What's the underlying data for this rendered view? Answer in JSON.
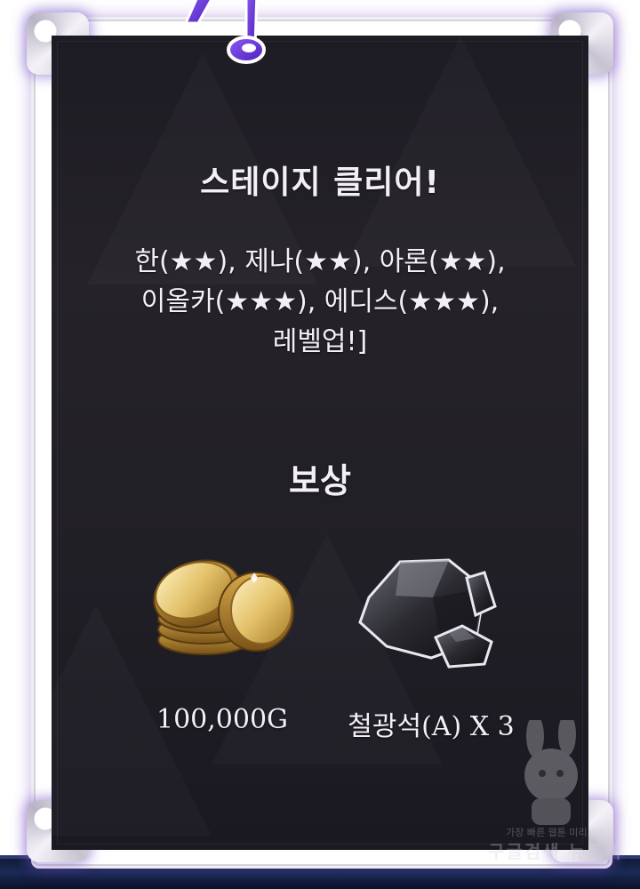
{
  "dialog": {
    "title": "스테이지 클리어!",
    "description_lines": [
      "한(★★), 제나(★★), 아론(★★),",
      "이올카(★★★), 에디스(★★★),",
      "레벨업!]"
    ]
  },
  "rewards": {
    "heading": "보상",
    "items": [
      {
        "label": "100,000G",
        "icon": "gold-coins-icon"
      },
      {
        "label": "철광석(A) X 3",
        "icon": "iron-ore-icon"
      }
    ]
  },
  "watermark": {
    "line1": "가장 빠른 웹툰 미리보기",
    "line2": "구글검색 뉴토끼"
  },
  "colors": {
    "panel_bg": "#211f26",
    "frame": "#ffffff",
    "glow": "#7a4fd0",
    "note": "#6c3fe0",
    "text": "#f2f0f5"
  }
}
